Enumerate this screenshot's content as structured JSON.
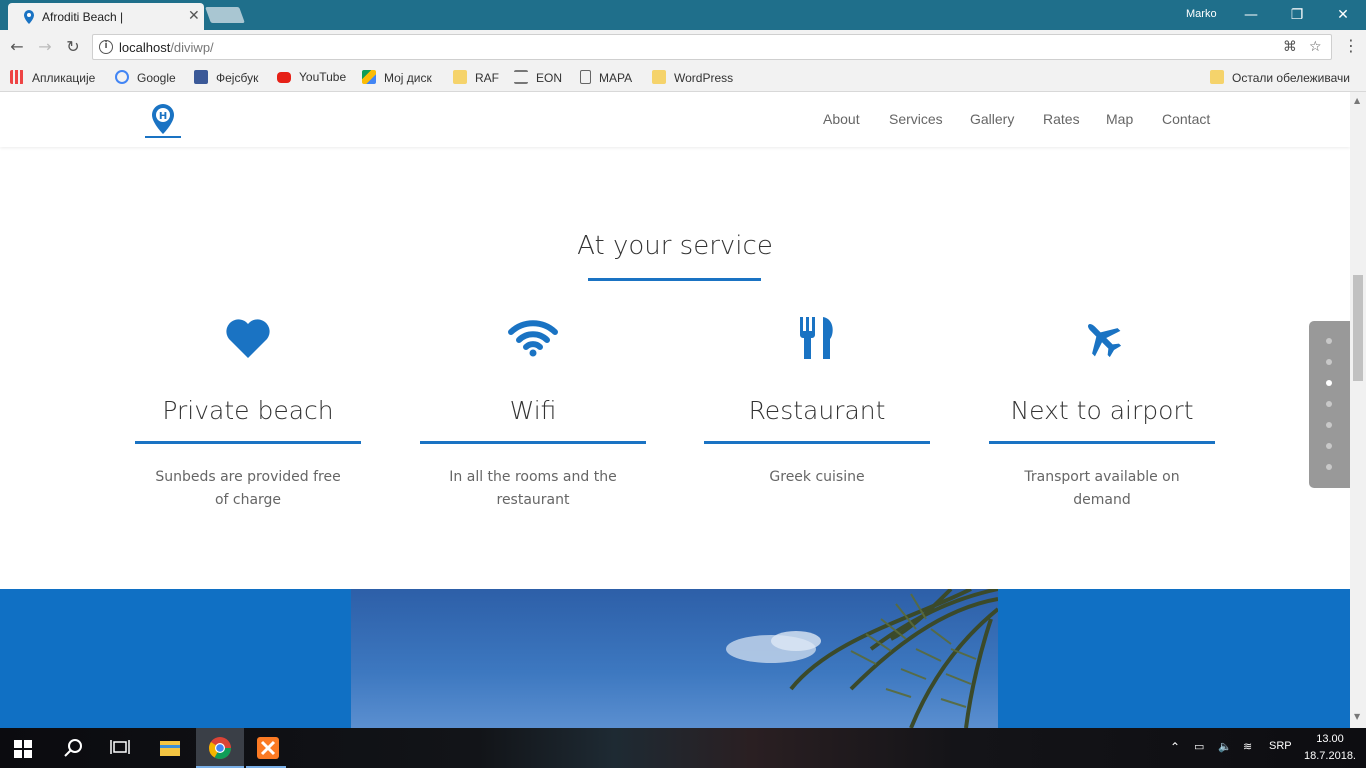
{
  "browser": {
    "tab_title": "Afroditi Beach |",
    "tab_close": "✕",
    "user_name": "Marko",
    "url_host": "localhost",
    "url_path": "/diviwp/",
    "bookmarks": [
      {
        "label": "Апликације",
        "icon": "apps-grid-icon"
      },
      {
        "label": "Google",
        "icon": "google-icon"
      },
      {
        "label": "Фејсбук",
        "icon": "facebook-icon"
      },
      {
        "label": "YouTube",
        "icon": "youtube-icon"
      },
      {
        "label": "Мој диск",
        "icon": "drive-icon"
      },
      {
        "label": "RAF",
        "icon": "folder-icon"
      },
      {
        "label": "EON",
        "icon": "eon-icon"
      },
      {
        "label": "MAPA",
        "icon": "page-icon"
      },
      {
        "label": "WordPress",
        "icon": "folder-icon"
      }
    ],
    "other_bookmarks": "Остали обележивачи"
  },
  "site": {
    "nav": [
      "About",
      "Services",
      "Gallery",
      "Rates",
      "Map",
      "Contact"
    ],
    "section_title": "At your service",
    "features": [
      {
        "icon": "heart-icon",
        "title": "Private beach",
        "desc": "Sunbeds are provided free of charge"
      },
      {
        "icon": "wifi-icon",
        "title": "Wifi",
        "desc": "In all the rooms and the restaurant"
      },
      {
        "icon": "restaurant-icon",
        "title": "Restaurant",
        "desc": "Greek cuisine"
      },
      {
        "icon": "airplane-icon",
        "title": "Next to airport",
        "desc": "Transport available on demand"
      }
    ],
    "dot_nav_active_index": 2,
    "accent_color": "#1a73c3"
  },
  "taskbar": {
    "language": "SRP",
    "time": "13.00",
    "date": "18.7.2018."
  }
}
